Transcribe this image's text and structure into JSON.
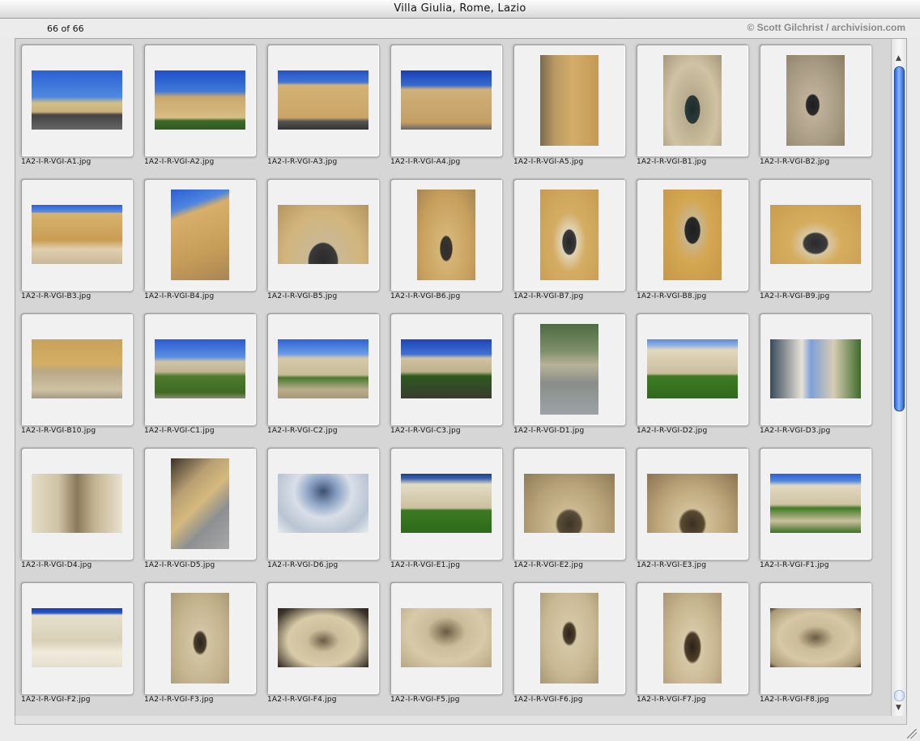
{
  "window": {
    "title": "Villa Giulia, Rome, Lazio"
  },
  "info": {
    "count": "66 of 66",
    "credit": "© Scott Gilchrist / archivision.com"
  },
  "icons": {
    "scroll_up": "arrow-up-icon",
    "scroll_down": "arrow-down-icon",
    "resize": "resize-grip-icon"
  },
  "items": [
    {
      "file": "1A2-I-R-VGI-A1.jpg",
      "orient": "land",
      "bg": "linear-gradient(#2a5fd0 0%,#4f8ae0 45%,#d4bf86 55%,#c9b27a 70%,#444 75%,#666 100%)"
    },
    {
      "file": "1A2-I-R-VGI-A2.jpg",
      "orient": "land",
      "bg": "linear-gradient(#1f4fc8 0%,#3f79d9 35%,#c9a86c 45%,#d9bd84 80%,#3d6a2a 85%,#2d5a22 100%)"
    },
    {
      "file": "1A2-I-R-VGI-A3.jpg",
      "orient": "land",
      "bg": "linear-gradient(#2452c4 0%,#4375d4 20%,#d4b376 25%,#c9a466 80%,#555 86%,#333 100%)"
    },
    {
      "file": "1A2-I-R-VGI-A4.jpg",
      "orient": "land",
      "bg": "linear-gradient(#1a3fb3 0%,#3669cf 25%,#d0b07a 32%,#c39f64 88%,#666 100%)"
    },
    {
      "file": "1A2-I-R-VGI-A5.jpg",
      "orient": "port",
      "bg": "linear-gradient(90deg,#7a6a52 0%,#b89a62 25%,#d2ad6a 55%,#c49a55 100%)"
    },
    {
      "file": "1A2-I-R-VGI-B1.jpg",
      "orient": "port",
      "bg": "radial-gradient(ellipse at 50% 60%,#1d2a2a 0%,#2b3a39 18%,#b8ab8c 19%,#cfc3a4 60%,#a6977a 100%)"
    },
    {
      "file": "1A2-I-R-VGI-B2.jpg",
      "orient": "port",
      "bg": "radial-gradient(ellipse at 45% 55%,#1e1e1e 0%,#2a2a2a 14%,#bfb199 16%,#a79a82 60%,#8b7e68 100%)"
    },
    {
      "file": "1A2-I-R-VGI-B3.jpg",
      "orient": "land",
      "bg": "linear-gradient(#2d62d6 0%,#5a8be0 12%,#d8b36d 14%,#c99d55 60%,#e0cfae 75%,#c9b998 100%)"
    },
    {
      "file": "1A2-I-R-VGI-B4.jpg",
      "orient": "port",
      "bg": "linear-gradient(160deg,#2a5fd0 0%,#4f86e0 20%,#d7af6a 28%,#c59b58 70%,#a78655 100%)"
    },
    {
      "file": "1A2-I-R-VGI-B5.jpg",
      "orient": "land",
      "bg": "radial-gradient(ellipse at 50% 95%,#2a2a2a 0%,#3a3a3a 22%,#c9b994 24%,#d2b57c 60%,#b59560 100%)"
    },
    {
      "file": "1A2-I-R-VGI-B6.jpg",
      "orient": "port",
      "bg": "radial-gradient(ellipse at 50% 65%,#2e2e2e 0%,#3a332b 14%,#d5b577 16%,#c69f5c 65%,#a68454 100%)"
    },
    {
      "file": "1A2-I-R-VGI-B7.jpg",
      "orient": "port",
      "bg": "radial-gradient(ellipse at 50% 58%,#262626 0%,#3a3a3a 16%,#e0d4b6 18%,#d4ad63 40%,#c79c52 100%)"
    },
    {
      "file": "1A2-I-R-VGI-B8.jpg",
      "orient": "port",
      "bg": "radial-gradient(ellipse at 50% 45%,#1e1e1e 0%,#2a2a2a 18%,#c9b48a 20%,#d4a752 45%,#c69848 100%)"
    },
    {
      "file": "1A2-I-R-VGI-B9.jpg",
      "orient": "land",
      "bg": "radial-gradient(ellipse at 50% 65%,#2b2b2b 0%,#3c3c3c 18%,#d8c7a0 21%,#d6ad5e 40%,#c99c4f 100%)"
    },
    {
      "file": "1A2-I-R-VGI-B10.jpg",
      "orient": "land",
      "bg": "linear-gradient(#c7a25b 0%,#d4ae63 40%,#b8a888 55%,#cfc3a5 85%,#a49b85 100%)"
    },
    {
      "file": "1A2-I-R-VGI-C1.jpg",
      "orient": "land",
      "bg": "linear-gradient(#2a5bd0 0%,#5b8fe2 30%,#cfc5a7 38%,#bfb493 55%,#4e7b2c 62%,#3e6a22 90%,#8a8a70 100%)"
    },
    {
      "file": "1A2-I-R-VGI-C2.jpg",
      "orient": "land",
      "bg": "linear-gradient(#2d63d6 0%,#6d9be6 25%,#d5c9a9 32%,#c8bc98 60%,#4b7a2c 65%,#b8ac8a 85%,#a69a7a 100%)"
    },
    {
      "file": "1A2-I-R-VGI-C3.jpg",
      "orient": "land",
      "bg": "linear-gradient(#1e46b8 0%,#3e70d2 25%,#cfc3a2 32%,#bdb08c 55%,#2e5a1f 62%,#3a3a30 100%)"
    },
    {
      "file": "1A2-I-R-VGI-D1.jpg",
      "orient": "port",
      "bg": "linear-gradient(#4e6b44 0%,#7e8f6a 30%,#b9b29a 45%,#8a8e88 65%,#9ba3a6 100%)"
    },
    {
      "file": "1A2-I-R-VGI-D2.jpg",
      "orient": "land",
      "bg": "linear-gradient(#5d89d6 0%,#8fb0e6 10%,#e2d8bd 18%,#c9bd9c 58%,#3f7a24 62%,#2f6a1c 100%)"
    },
    {
      "file": "1A2-I-R-VGI-D3.jpg",
      "orient": "land",
      "bg": "linear-gradient(90deg,#3a4a5a 0%,#e6e2d8 35%,#7da0d8 45%,#d7cdb2 70%,#3e6b2a 100%)"
    },
    {
      "file": "1A2-I-R-VGI-D4.jpg",
      "orient": "land",
      "bg": "linear-gradient(90deg,#e3dcc8 0%,#cfc2a2 30%,#8a7a5a 50%,#c4b592 70%,#e9e2d0 100%)"
    },
    {
      "file": "1A2-I-R-VGI-D5.jpg",
      "orient": "port",
      "bg": "linear-gradient(135deg,#3b3229 0%,#b89f73 30%,#d4b97c 50%,#8d8f91 70%,#a6a8aa 100%)"
    },
    {
      "file": "1A2-I-R-VGI-D6.jpg",
      "orient": "land",
      "bg": "radial-gradient(ellipse at 50% 30%,#3d4f72 0%,#8aa0c2 22%,#d8dfe8 45%,#b8c4d2 75%,#e8ecf0 100%)"
    },
    {
      "file": "1A2-I-R-VGI-E1.jpg",
      "orient": "land",
      "bg": "linear-gradient(#1f3f8a 0%,#3d5ea8 8%,#e3dcc6 18%,#cbbf9e 58%,#3d7a24 62%,#2d6a1a 100%)"
    },
    {
      "file": "1A2-I-R-VGI-E2.jpg",
      "orient": "land",
      "bg": "radial-gradient(ellipse at 50% 85%,#3d3528 0%,#5a4c38 18%,#cbb992 22%,#b9a47a 55%,#8f7c58 100%)"
    },
    {
      "file": "1A2-I-R-VGI-E3.jpg",
      "orient": "land",
      "bg": "radial-gradient(ellipse at 50% 85%,#3a3022 0%,#5b4a33 18%,#d1bf98 22%,#bda57a 55%,#8a7452 100%)"
    },
    {
      "file": "1A2-I-R-VGI-F1.jpg",
      "orient": "land",
      "bg": "linear-gradient(#2b5fcf 0%,#5285e0 12%,#e1d9c2 20%,#cfc3a3 52%,#3f7b25 58%,#cbbf9f 80%,#3a7023 100%)"
    },
    {
      "file": "1A2-I-R-VGI-F2.jpg",
      "orient": "land",
      "bg": "linear-gradient(#1d3fa8 0%,#2b55c0 8%,#e6e0cc 12%,#d8cfb6 55%,#f0ebdc 75%,#e5dfcd 100%)"
    },
    {
      "file": "1A2-I-R-VGI-F3.jpg",
      "orient": "port",
      "bg": "radial-gradient(ellipse at 50% 55%,#2a241c 0%,#4a3d2a 14%,#d2c5a3 18%,#c4b48e 60%,#a99a77 100%)"
    },
    {
      "file": "1A2-I-R-VGI-F4.jpg",
      "orient": "land",
      "bg": "radial-gradient(ellipse at 50% 55%,#6a5c45 0%,#cdbf9c 25%,#d8cba8 55%,#3b3327 88%,#2a241b 100%)"
    },
    {
      "file": "1A2-I-R-VGI-F5.jpg",
      "orient": "land",
      "bg": "radial-gradient(ellipse at 50% 40%,#6b5c42 0%,#cbbd9a 30%,#d7caa8 60%,#b7a883 100%)"
    },
    {
      "file": "1A2-I-R-VGI-F6.jpg",
      "orient": "port",
      "bg": "radial-gradient(ellipse at 50% 45%,#2c2419 0%,#4c3f2c 14%,#d4c7a5 18%,#c8b994 60%,#a89977 100%)"
    },
    {
      "file": "1A2-I-R-VGI-F7.jpg",
      "orient": "port",
      "bg": "radial-gradient(ellipse at 50% 60%,#2a2217 0%,#4c3e2a 18%,#d6c9a6 22%,#c6b58f 60%,#a89673 100%)"
    },
    {
      "file": "1A2-I-R-VGI-F8.jpg",
      "orient": "land",
      "bg": "radial-gradient(ellipse at 50% 50%,#6a5b43 0%,#cbbc98 28%,#d6c8a5 58%,#a99873 90%,#3a3226 100%)"
    }
  ]
}
